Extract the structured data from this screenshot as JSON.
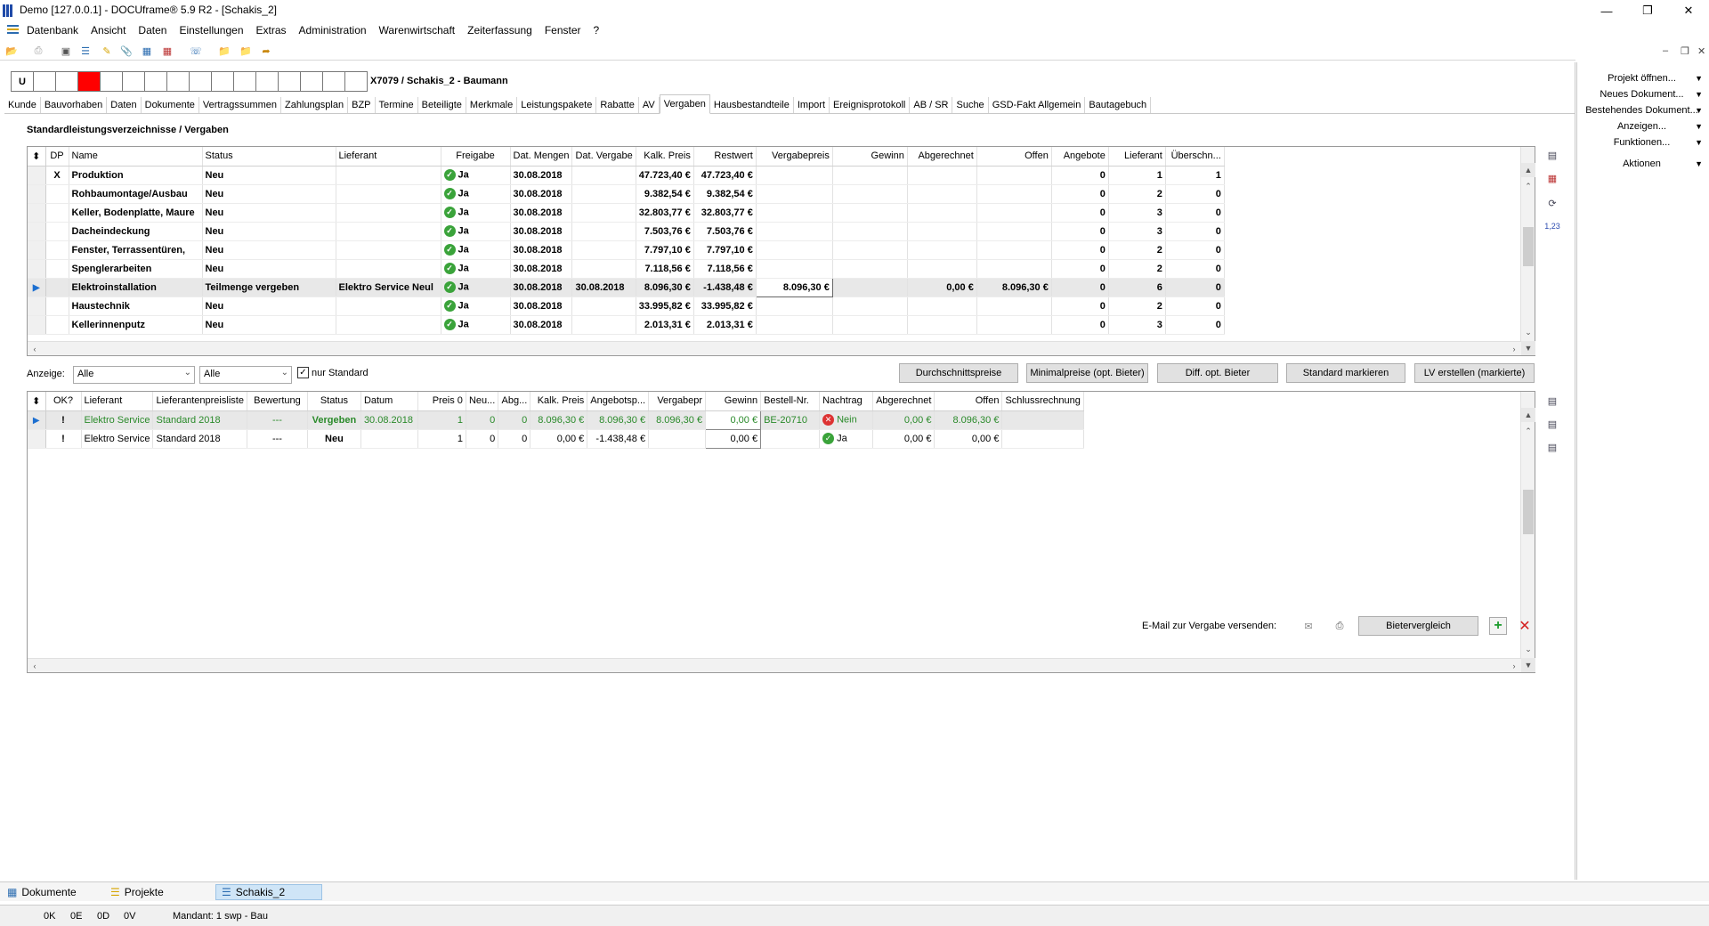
{
  "window": {
    "title": "Demo [127.0.0.1] - DOCUframe® 5.9 R2 - [Schakis_2]"
  },
  "menu": [
    "Datenbank",
    "Ansicht",
    "Daten",
    "Einstellungen",
    "Extras",
    "Administration",
    "Warenwirtschaft",
    "Zeiterfassung",
    "Fenster",
    "?"
  ],
  "header": {
    "boxes": [
      "U",
      "",
      "",
      "",
      "",
      "",
      "",
      "",
      "",
      "",
      "",
      "",
      "",
      "",
      "",
      ""
    ],
    "red_box_index": 3,
    "project": "X7079 / Schakis_2 - Baumann"
  },
  "tabs": [
    "Kunde",
    "Bauvorhaben",
    "Daten",
    "Dokumente",
    "Vertragssummen",
    "Zahlungsplan",
    "BZP",
    "Termine",
    "Beteiligte",
    "Merkmale",
    "Leistungspakete",
    "Rabatte",
    "AV",
    "Vergaben",
    "Hausbestandteile",
    "Import",
    "Ereignisprotokoll",
    "AB / SR",
    "Suche",
    "GSD-Fakt Allgemein",
    "Bautagebuch"
  ],
  "active_tab": "Vergaben",
  "section_title": "Standardleistungsverzeichnisse / Vergaben",
  "table1": {
    "columns": [
      "DP",
      "Name",
      "Status",
      "Lieferant",
      "Freigabe",
      "Dat. Mengen",
      "Dat. Vergabe",
      "Kalk. Preis",
      "Restwert",
      "Vergabepreis",
      "Gewinn",
      "Abgerechnet",
      "Offen",
      "Angebote",
      "Lieferant",
      "Überschn..."
    ],
    "rows": [
      [
        "X",
        "Produktion",
        "Neu",
        "",
        "Ja",
        "30.08.2018",
        "",
        "47.723,40 €",
        "47.723,40 €",
        "",
        "",
        "",
        "",
        "0",
        "1",
        "1"
      ],
      [
        "",
        "Rohbaumontage/Ausbau",
        "Neu",
        "",
        "Ja",
        "30.08.2018",
        "",
        "9.382,54 €",
        "9.382,54 €",
        "",
        "",
        "",
        "",
        "0",
        "2",
        "0"
      ],
      [
        "",
        "Keller, Bodenplatte, Maure",
        "Neu",
        "",
        "Ja",
        "30.08.2018",
        "",
        "32.803,77 €",
        "32.803,77 €",
        "",
        "",
        "",
        "",
        "0",
        "3",
        "0"
      ],
      [
        "",
        "Dacheindeckung",
        "Neu",
        "",
        "Ja",
        "30.08.2018",
        "",
        "7.503,76 €",
        "7.503,76 €",
        "",
        "",
        "",
        "",
        "0",
        "3",
        "0"
      ],
      [
        "",
        "Fenster, Terrassentüren,",
        "Neu",
        "",
        "Ja",
        "30.08.2018",
        "",
        "7.797,10 €",
        "7.797,10 €",
        "",
        "",
        "",
        "",
        "0",
        "2",
        "0"
      ],
      [
        "",
        "Spenglerarbeiten",
        "Neu",
        "",
        "Ja",
        "30.08.2018",
        "",
        "7.118,56 €",
        "7.118,56 €",
        "",
        "",
        "",
        "",
        "0",
        "2",
        "0"
      ],
      [
        "",
        "Elektroinstallation",
        "Teilmenge vergeben",
        "Elektro Service Neul",
        "Ja",
        "30.08.2018",
        "30.08.2018",
        "8.096,30 €",
        "-1.438,48 €",
        "8.096,30 €",
        "",
        "0,00 €",
        "8.096,30 €",
        "0",
        "6",
        "0"
      ],
      [
        "",
        "Haustechnik",
        "Neu",
        "",
        "Ja",
        "30.08.2018",
        "",
        "33.995,82 €",
        "33.995,82 €",
        "",
        "",
        "",
        "",
        "0",
        "2",
        "0"
      ],
      [
        "",
        "Kellerinnenputz",
        "Neu",
        "",
        "Ja",
        "30.08.2018",
        "",
        "2.013,31 €",
        "2.013,31 €",
        "",
        "",
        "",
        "",
        "0",
        "3",
        "0"
      ]
    ],
    "selected_row": 6
  },
  "filter": {
    "label": "Anzeige:",
    "select1": "Alle",
    "select2": "Alle",
    "nur_standard_label": "nur Standard",
    "nur_standard_checked": true
  },
  "buttons": {
    "durchschnitt": "Durchschnittspreise",
    "minimal": "Minimalpreise (opt. Bieter)",
    "diff": "Diff. opt. Bieter",
    "standard": "Standard markieren",
    "lv": "LV erstellen (markierte)",
    "bietervergleich": "Bietervergleich"
  },
  "table2": {
    "columns": [
      "OK?",
      "Lieferant",
      "Lieferantenpreisliste",
      "Bewertung",
      "Status",
      "Datum",
      "Preis 0",
      "Neu...",
      "Abg...",
      "Kalk. Preis",
      "Angebotsp...",
      "Vergabepr",
      "Gewinn",
      "Bestell-Nr.",
      "Nachtrag",
      "Abgerechnet",
      "Offen",
      "Schlussrechnung"
    ],
    "rows": [
      [
        "!",
        "Elektro Service",
        "Standard 2018",
        "---",
        "Vergeben",
        "30.08.2018",
        "1",
        "0",
        "0",
        "8.096,30 €",
        "8.096,30 €",
        "8.096,30 €",
        "0,00 €",
        "BE-20710",
        "Nein",
        "0,00 €",
        "8.096,30 €",
        ""
      ],
      [
        "!",
        "Elektro Service",
        "Standard 2018",
        "---",
        "Neu",
        "",
        "1",
        "0",
        "0",
        "0,00 €",
        "-1.438,48 €",
        "",
        "0,00 €",
        "",
        "Ja",
        "0,00 €",
        "0,00 €",
        ""
      ]
    ]
  },
  "email_label": "E-Mail zur Vergabe versenden:",
  "right_panel": [
    "Projekt öffnen...",
    "Neues Dokument...",
    "Bestehendes Dokument...",
    "Anzeigen...",
    "Funktionen...",
    "Aktionen"
  ],
  "bottom_tabs": [
    "Dokumente",
    "Projekte",
    "Schakis_2"
  ],
  "status": [
    "0K",
    "0E",
    "0D",
    "0V",
    "Mandant: 1 swp - Bau"
  ],
  "side_icons": {
    "num_label": "1,23"
  },
  "colors": {
    "accent": "#1c6fd0",
    "vergeben_green": "#2a8a2a",
    "red_box": "#ff0000"
  }
}
